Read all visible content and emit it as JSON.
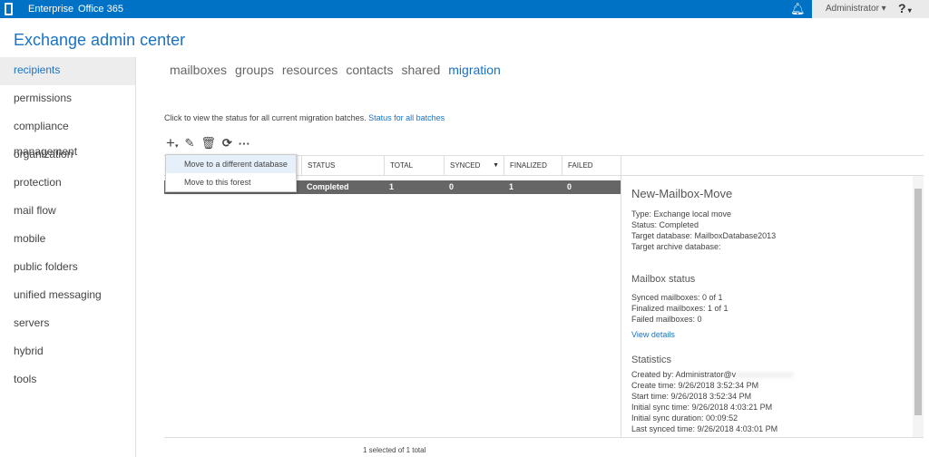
{
  "topbar": {
    "links": [
      "Enterprise",
      "Office 365"
    ],
    "user": "Administrator",
    "help": "?"
  },
  "title": "Exchange admin center",
  "sidebar": {
    "items": [
      "recipients",
      "permissions",
      "compliance management",
      "organization",
      "protection",
      "mail flow",
      "mobile",
      "public folders",
      "unified messaging",
      "servers",
      "hybrid",
      "tools"
    ],
    "selected": "recipients"
  },
  "tabs": {
    "items": [
      "mailboxes",
      "groups",
      "resources",
      "contacts",
      "shared",
      "migration"
    ],
    "active": "migration"
  },
  "info": {
    "text": "Click to view the status for all current migration batches.",
    "link": "Status for all batches"
  },
  "toolbar": {
    "icons": [
      "add-icon",
      "edit-icon",
      "delete-icon",
      "refresh-icon",
      "more-icon"
    ]
  },
  "menu": {
    "items": [
      "Move to a different database",
      "Move to this forest"
    ]
  },
  "table": {
    "columns": [
      "STATUS",
      "TOTAL",
      "SYNCED",
      "FINALIZED",
      "FAILED"
    ],
    "rows": [
      {
        "status": "Completed",
        "total": "1",
        "synced": "0",
        "finalized": "1",
        "failed": "0"
      }
    ]
  },
  "detail": {
    "title": "New-Mailbox-Move",
    "props": [
      "Type: Exchange local move",
      "Status: Completed",
      "Target database: MailboxDatabase2013",
      "Target archive database:"
    ],
    "mailbox_heading": "Mailbox status",
    "mailbox": [
      "Synced mailboxes: 0 of 1",
      "Finalized mailboxes: 1 of 1",
      "Failed mailboxes: 0"
    ],
    "view_details": "View details",
    "stats_heading": "Statistics",
    "created_by": "Created by: Administrator@v",
    "stats": [
      "Create time: 9/26/2018 3:52:34 PM",
      "Start time: 9/26/2018 3:52:34 PM",
      "Initial sync time: 9/26/2018 4:03:21 PM",
      "Initial sync duration: 00:09:52",
      "Last synced time: 9/26/2018 4:03:01 PM"
    ]
  },
  "footer": "1 selected of 1 total",
  "colors": {
    "accent": "#0072c6",
    "link": "#1a72c4",
    "selected_row": "#666666"
  }
}
